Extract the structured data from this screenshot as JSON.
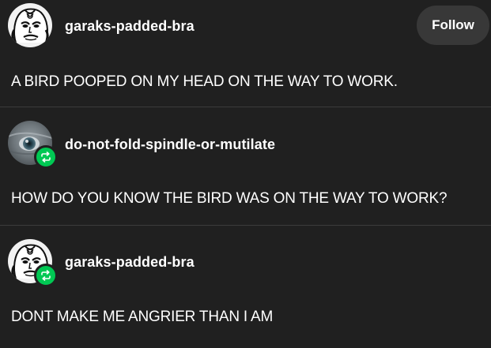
{
  "posts": [
    {
      "username": "garaks-padded-bra",
      "text": "A BIRD POOPED ON MY HEAD ON THE WAY TO WORK.",
      "avatar_icon": "garak-face-avatar",
      "follow_label": "Follow",
      "reblogged": false
    },
    {
      "username": "do-not-fold-spindle-or-mutilate",
      "text": "HOW DO YOU KNOW THE BIRD WAS ON THE WAY TO WORK?",
      "avatar_icon": "eye-closeup-avatar",
      "reblogged": true
    },
    {
      "username": "garaks-padded-bra",
      "text": "DONT MAKE ME ANGRIER THAN I AM",
      "avatar_icon": "garak-face-avatar",
      "reblogged": true
    }
  ],
  "colors": {
    "background": "#202020",
    "text": "#ffffff",
    "follow_button_bg": "#383838",
    "reblog_badge": "#00c853",
    "divider": "#3c3c3c"
  }
}
